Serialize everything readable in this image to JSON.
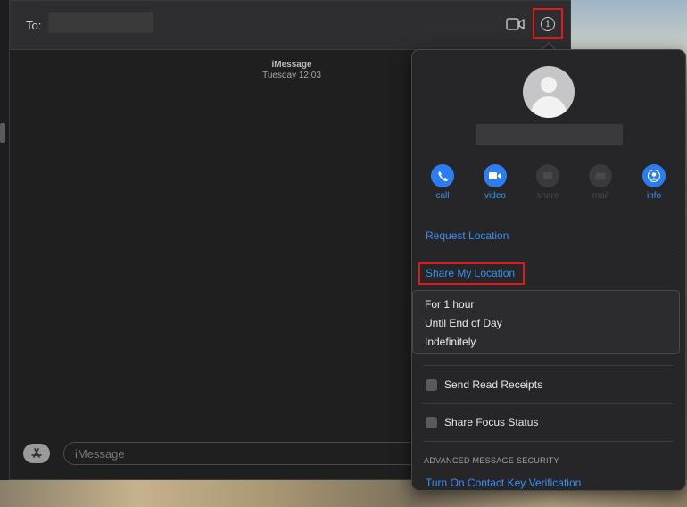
{
  "header": {
    "to_label": "To:",
    "video_icon": "video-camera-icon",
    "info_icon": "info-icon"
  },
  "conversation": {
    "service": "iMessage",
    "timestamp": "Tuesday 12:03"
  },
  "compose": {
    "placeholder": "iMessage",
    "apps_icon": "app-store-icon"
  },
  "popover": {
    "actions": [
      {
        "label": "call",
        "icon": "phone-icon",
        "enabled": true
      },
      {
        "label": "video",
        "icon": "video-camera-icon",
        "enabled": true
      },
      {
        "label": "share",
        "icon": "share-screen-icon",
        "enabled": false
      },
      {
        "label": "mail",
        "icon": "mail-icon",
        "enabled": false
      },
      {
        "label": "info",
        "icon": "person-icon",
        "enabled": true
      }
    ],
    "request_location": "Request Location",
    "share_my_location": "Share My Location",
    "share_options": [
      "For 1 hour",
      "Until End of Day",
      "Indefinitely"
    ],
    "send_read_receipts": "Send Read Receipts",
    "share_focus_status": "Share Focus Status",
    "advanced_section": "ADVANCED MESSAGE SECURITY",
    "contact_key_link": "Turn On Contact Key Verification"
  },
  "colors": {
    "accent": "#3b8ff2",
    "highlight": "#e01a1a"
  }
}
